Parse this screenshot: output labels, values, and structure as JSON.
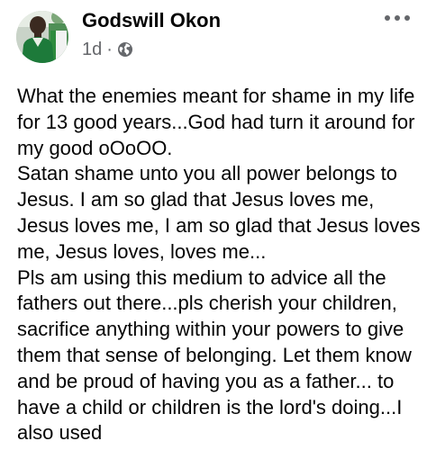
{
  "post": {
    "author": "Godswill Okon",
    "timestamp": "1d",
    "separator": "·",
    "audience_icon": "globe-icon",
    "menu_icon": "more-horizontal-icon",
    "body": "What the enemies meant for shame in my life for 13 good years...God had turn it around for my good oOoOO.\nSatan shame unto you all power belongs to Jesus. I am so glad that Jesus loves me, Jesus loves me, I am so glad that Jesus loves me, Jesus loves, loves me...\nPls am using this medium to advice all the fathers out there...pls cherish your children, sacrifice anything within your powers to give them that sense of belonging. Let them know and be proud of having you as a father... to have a child or children is the lord's doing...I also used"
  },
  "colors": {
    "text_primary": "#050505",
    "text_secondary": "#65676b",
    "background": "#ffffff"
  }
}
